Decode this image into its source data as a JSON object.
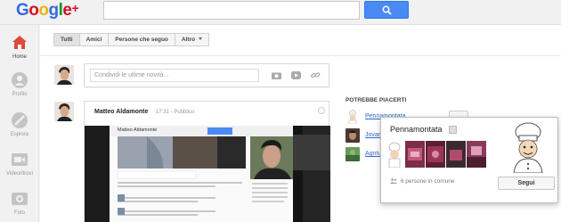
{
  "app": {
    "logo_text": "Google+",
    "search_placeholder": ""
  },
  "nav": [
    {
      "label": "Home",
      "icon": "home-icon",
      "active": true
    },
    {
      "label": "Profilo",
      "icon": "profile-icon",
      "active": false
    },
    {
      "label": "Esplora",
      "icon": "explore-icon",
      "active": false
    },
    {
      "label": "Videoritrovi",
      "icon": "hangout-video-icon",
      "active": false
    },
    {
      "label": "Foto",
      "icon": "camera-icon",
      "active": false
    }
  ],
  "filters": {
    "all": "Tutti",
    "friends": "Amici",
    "following": "Persone che seguo",
    "more": "Altro"
  },
  "share": {
    "placeholder": "Condividi le ultime novità..."
  },
  "post": {
    "author": "Matteo Aldamonte",
    "time": "17:31",
    "visibility": "Pubblico",
    "embedded_name": "Matteo Aldamonte"
  },
  "suggestions": {
    "title": "POTREBBE PIACERTI",
    "items": [
      "Pennamontata",
      "Jovan",
      "Agntu"
    ]
  },
  "hovercard": {
    "name": "Pennamontata",
    "common": "6 persone in comune",
    "follow_label": "Segui"
  },
  "colors": {
    "accent_blue": "#4a8af4",
    "link_blue": "#3366cc",
    "nav_red": "#dd4b39"
  }
}
